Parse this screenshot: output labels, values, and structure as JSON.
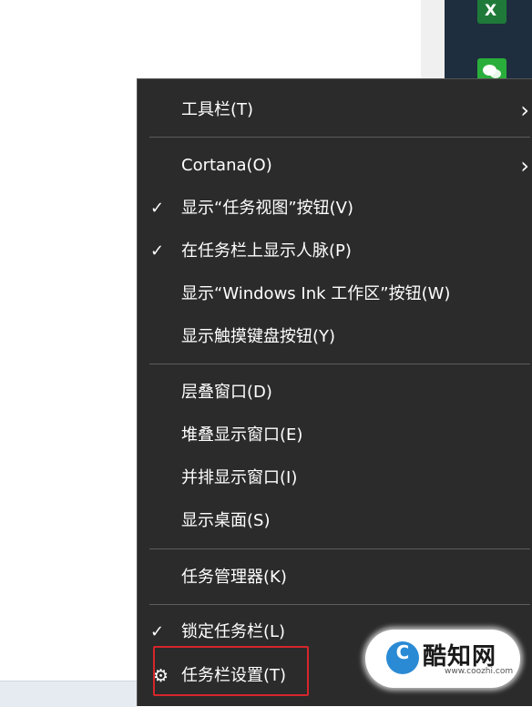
{
  "menu": {
    "items": [
      {
        "label": "工具栏(T)",
        "checked": false,
        "submenu": true
      },
      {
        "label": "Cortana(O)",
        "checked": false,
        "submenu": true
      },
      {
        "label": "显示“任务视图”按钮(V)",
        "checked": true,
        "submenu": false
      },
      {
        "label": "在任务栏上显示人脉(P)",
        "checked": true,
        "submenu": false
      },
      {
        "label": "显示“Windows Ink 工作区”按钮(W)",
        "checked": false,
        "submenu": false
      },
      {
        "label": "显示触摸键盘按钮(Y)",
        "checked": false,
        "submenu": false
      },
      {
        "label": "层叠窗口(D)",
        "checked": false,
        "submenu": false
      },
      {
        "label": "堆叠显示窗口(E)",
        "checked": false,
        "submenu": false
      },
      {
        "label": "并排显示窗口(I)",
        "checked": false,
        "submenu": false
      },
      {
        "label": "显示桌面(S)",
        "checked": false,
        "submenu": false
      },
      {
        "label": "任务管理器(K)",
        "checked": false,
        "submenu": false
      },
      {
        "label": "锁定任务栏(L)",
        "checked": true,
        "submenu": false
      },
      {
        "label": "任务栏设置(T)",
        "checked": false,
        "submenu": false,
        "icon": "gear-icon"
      }
    ],
    "check_glyph": "✓",
    "arrow_glyph": "›",
    "gear_glyph": "⚙"
  },
  "watermark": {
    "logo_letter": "C",
    "text": "酷知网",
    "url": "www.coozhi.com"
  },
  "colors": {
    "menu_bg": "#2b2b2b",
    "menu_text": "#ffffff",
    "highlight_border": "#d6262b",
    "taskbar": "#1e2e3e"
  }
}
